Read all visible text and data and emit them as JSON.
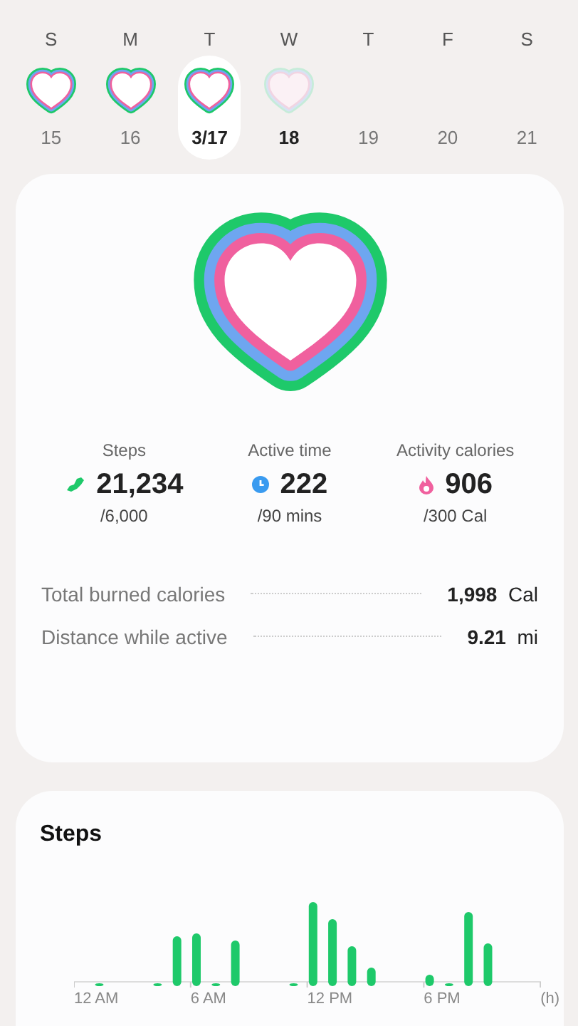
{
  "week": [
    {
      "weekday": "S",
      "date": "15",
      "kind": "full",
      "selected": false,
      "today": false
    },
    {
      "weekday": "M",
      "date": "16",
      "kind": "full",
      "selected": false,
      "today": false
    },
    {
      "weekday": "T",
      "date": "3/17",
      "kind": "full",
      "selected": true,
      "today": false
    },
    {
      "weekday": "W",
      "date": "18",
      "kind": "faint",
      "selected": false,
      "today": true
    },
    {
      "weekday": "T",
      "date": "19",
      "kind": "none",
      "selected": false,
      "today": false
    },
    {
      "weekday": "F",
      "date": "20",
      "kind": "none",
      "selected": false,
      "today": false
    },
    {
      "weekday": "S",
      "date": "21",
      "kind": "none",
      "selected": false,
      "today": false
    }
  ],
  "summary": {
    "stats": [
      {
        "kind": "steps",
        "label": "Steps",
        "value": "21,234",
        "goal": "/6,000"
      },
      {
        "kind": "time",
        "label": "Active time",
        "value": "222",
        "goal": "/90 mins"
      },
      {
        "kind": "calories",
        "label": "Activity calories",
        "value": "906",
        "goal": "/300 Cal"
      }
    ],
    "details": [
      {
        "label": "Total burned calories",
        "value": "1,998",
        "unit": "Cal"
      },
      {
        "label": "Distance while active",
        "value": "9.21",
        "unit": "mi"
      }
    ]
  },
  "steps_chart": {
    "title": "Steps",
    "x_labels": [
      "12 AM",
      "6 AM",
      "12 PM",
      "6 PM"
    ],
    "unit": "(h)"
  }
}
